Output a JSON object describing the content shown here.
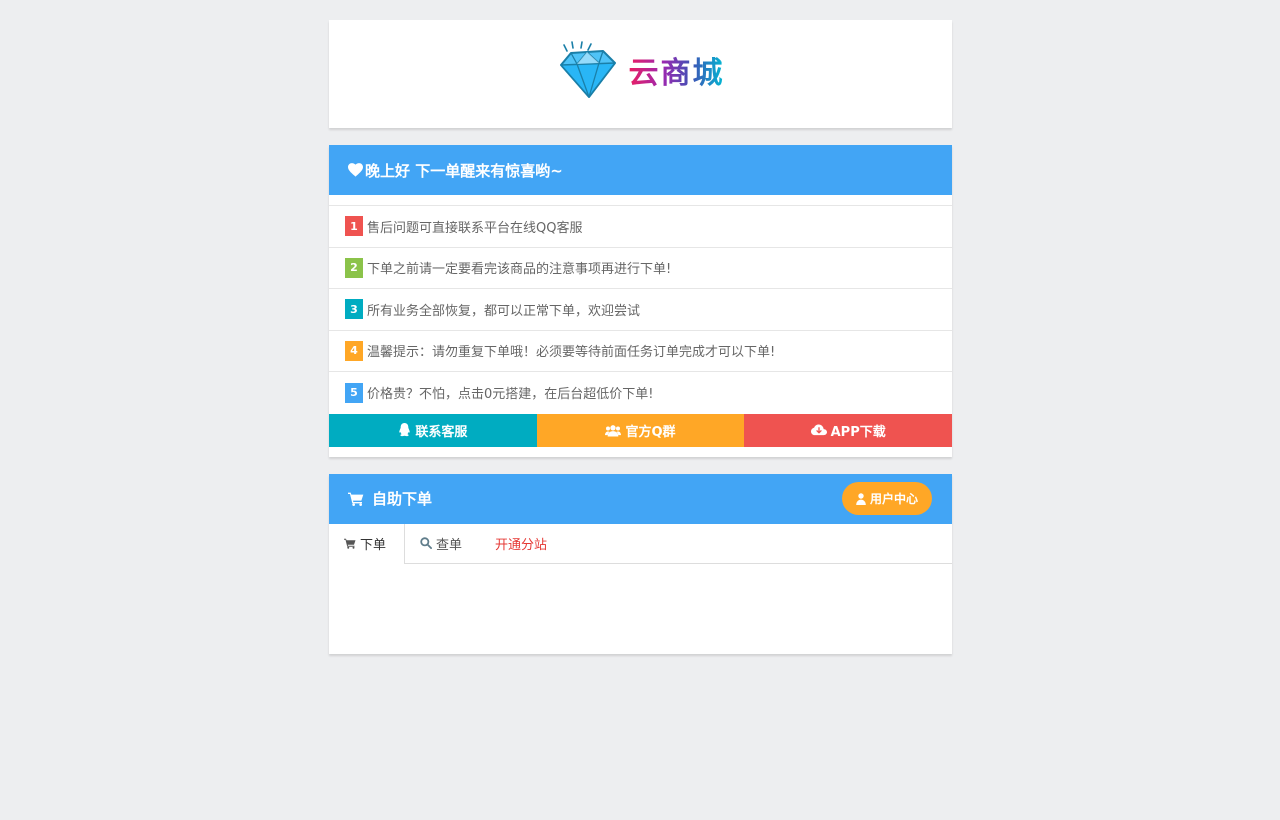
{
  "logo": {
    "text": "云商城",
    "icon": "diamond-icon"
  },
  "notice": {
    "title": "晚上好 下一单醒来有惊喜哟~",
    "icon": "heart-icon",
    "items": [
      {
        "num": "1",
        "text": "售后问题可直接联系平台在线QQ客服",
        "color": "#ef5350"
      },
      {
        "num": "2",
        "text": "下单之前请一定要看完该商品的注意事项再进行下单!",
        "color": "#8bc34a"
      },
      {
        "num": "3",
        "text": "所有业务全部恢复，都可以正常下单，欢迎尝试",
        "color": "#00acc1"
      },
      {
        "num": "4",
        "text": "温馨提示：请勿重复下单哦！必须要等待前面任务订单完成才可以下单!",
        "color": "#ffa726"
      },
      {
        "num": "5",
        "text": "价格贵？不怕，点击0元搭建，在后台超低价下单!",
        "color": "#42a5f5"
      }
    ],
    "buttons": [
      {
        "label": "联系客服",
        "icon": "qq-icon",
        "color": "#00acc1"
      },
      {
        "label": "官方Q群",
        "icon": "users-icon",
        "color": "#ffa726"
      },
      {
        "label": "APP下载",
        "icon": "cloud-download-icon",
        "color": "#ef5350"
      }
    ]
  },
  "order": {
    "title": "自助下单",
    "title_icon": "cart-icon",
    "user_center": "用户中心",
    "tabs": [
      {
        "label": "下单",
        "icon": "cart-icon"
      },
      {
        "label": "查单",
        "icon": "search-icon"
      },
      {
        "label": "开通分站"
      }
    ]
  },
  "colors": {
    "header_blue": "#42a5f5",
    "orange": "#ffa726",
    "teal": "#00acc1",
    "red": "#ef5350",
    "background": "#edeef0"
  }
}
